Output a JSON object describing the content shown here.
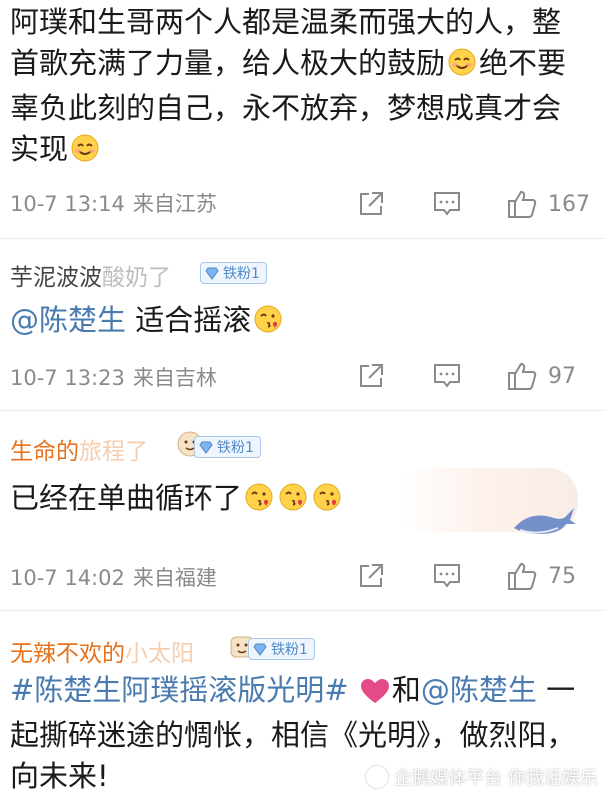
{
  "comments": [
    {
      "text_1": "阿璞和生哥两个人都是温柔而强大的人，整首歌充满了力量，给人极大的鼓励",
      "text_2": "绝不要辜负此刻的自己，永不放弃，梦想成真才会实现",
      "time": "10-7 13:14",
      "location": "来自江苏",
      "likes": "167"
    },
    {
      "user": "芋泥波波",
      "user_faded": "酸奶了",
      "badge": "铁粉1",
      "mention": "@陈楚生",
      "text": "适合摇滚",
      "time": "10-7 13:23",
      "location": "来自吉林",
      "likes": "97"
    },
    {
      "user": "生命的",
      "user_faded": "旅程了",
      "badge": "铁粉1",
      "text": "已经在单曲循环了",
      "time": "10-7 14:02",
      "location": "来自福建",
      "likes": "75"
    },
    {
      "user": "无辣不欢的",
      "user_faded": "小太阳",
      "badge": "铁粉1",
      "hashtag": "#陈楚生阿璞摇滚版光明#",
      "text_1": "和",
      "mention": "@陈楚生",
      "text_2": "一起撕碎迷途的惆怅，相信《光明》，做烈阳，向未来!"
    }
  ],
  "watermark": "企鹅媒体平台 你我话娱乐",
  "colors": {
    "accent_link": "#4a7bb0",
    "meta_gray": "#8a8a8a",
    "username_orange": "#e8721c",
    "badge_blue": "#4f89c9"
  }
}
